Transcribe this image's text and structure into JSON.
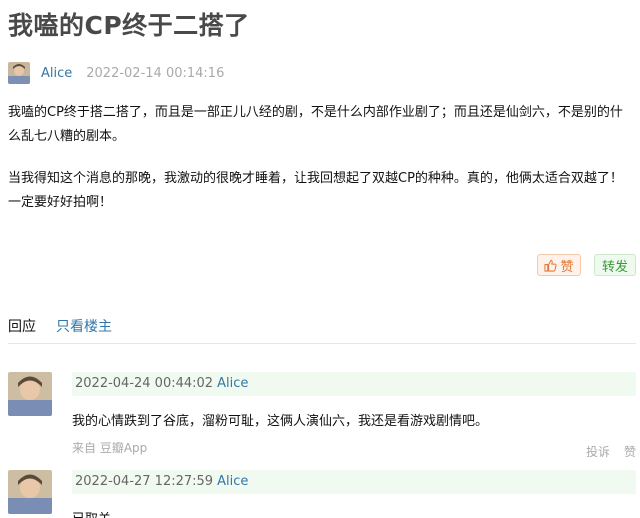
{
  "post": {
    "title": "我嗑的CP终于二搭了",
    "author": "Alice",
    "time": "2022-02-14 00:14:16",
    "paragraphs": [
      "我嗑的CP终于搭二搭了，而且是一部正儿八经的剧，不是什么内部作业剧了；而且还是仙剑六，不是别的什么乱七八糟的剧本。",
      "当我得知这个消息的那晚，我激动的很晚才睡着，让我回想起了双越CP的种种。真的，他俩太适合双越了！一定要好好拍啊！"
    ]
  },
  "actions": {
    "like_label": "赞",
    "forward_label": "转发"
  },
  "tabs": {
    "reply": "回应",
    "owner_only": "只看楼主"
  },
  "comments": [
    {
      "time": "2022-04-24 00:44:02",
      "author": "Alice",
      "text": "我的心情跌到了谷底，溜粉可耻，这俩人演仙六，我还是看游戏剧情吧。",
      "source": "来自 豆瓣App",
      "report": "投诉",
      "like": "赞"
    },
    {
      "time": "2022-04-27 12:27:59",
      "author": "Alice",
      "text": "已取关"
    }
  ],
  "colors": {
    "link": "#3377aa",
    "muted": "#aaaaaa",
    "like_bg": "#fff2ea",
    "forward_bg": "#effaee",
    "comment_head_bg": "#f0faf0"
  },
  "icons": {
    "like": "thumbs-up-icon"
  }
}
